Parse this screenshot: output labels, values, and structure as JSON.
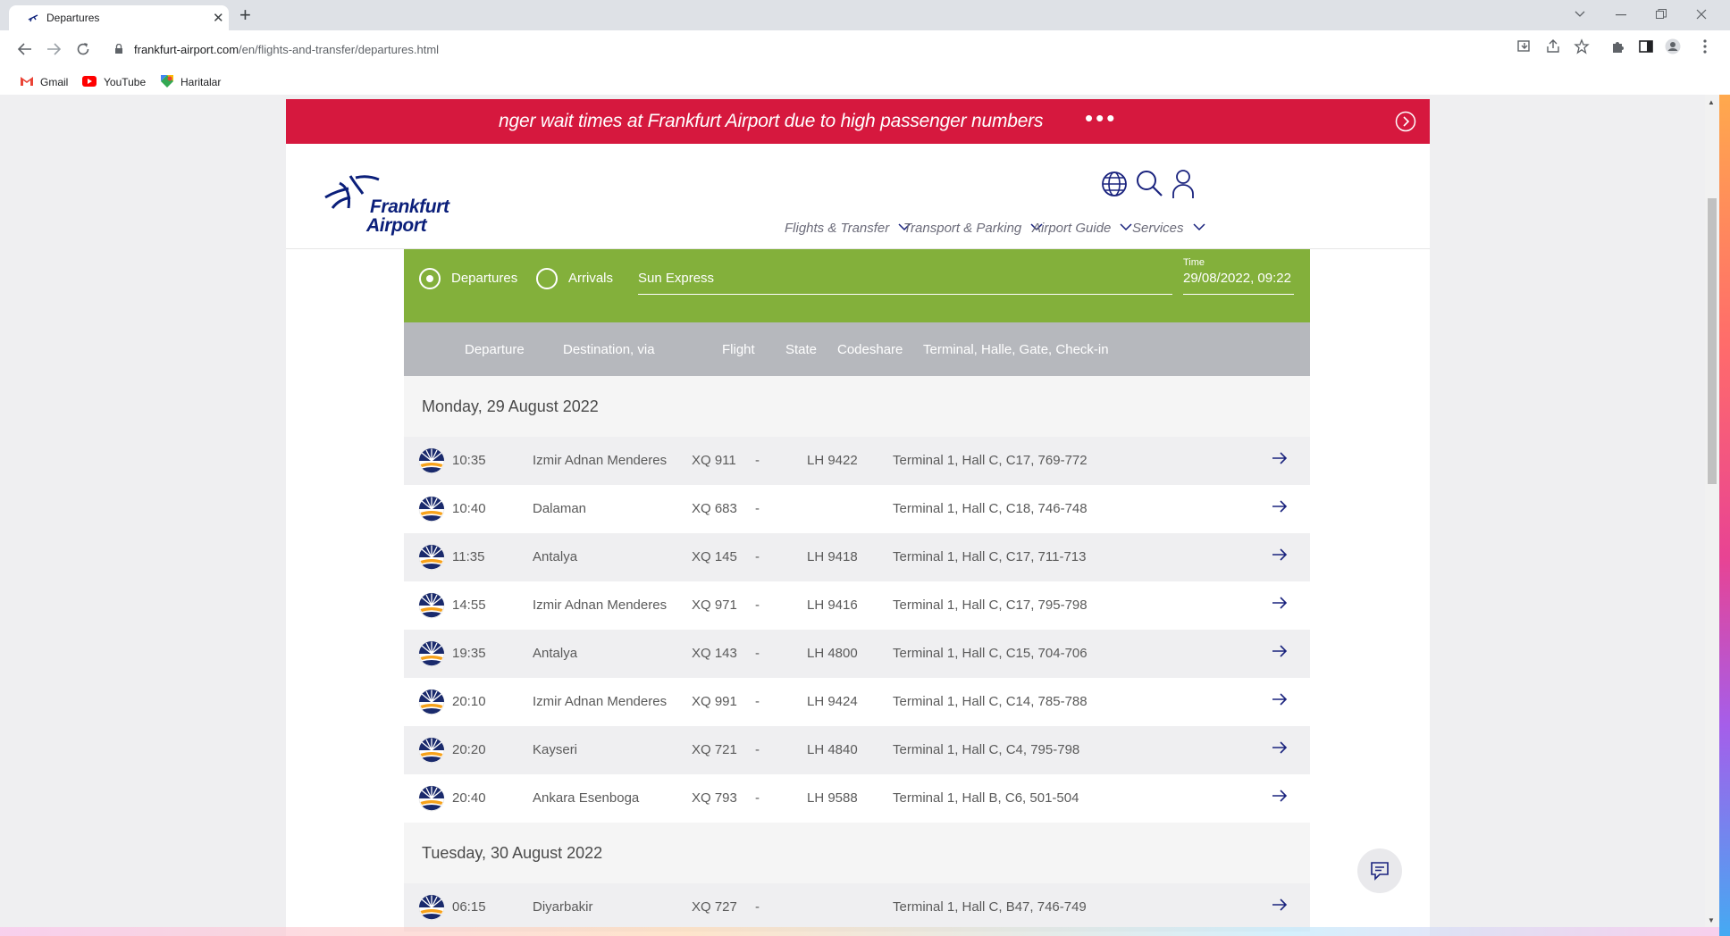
{
  "browser": {
    "tab_title": "Departures",
    "tab_close": "✕",
    "new_tab": "+",
    "url_host": "frankfurt-airport.com",
    "url_path": "/en/flights-and-transfer/departures.html",
    "bookmarks": [
      {
        "label": "Gmail",
        "icon": "gmail-icon"
      },
      {
        "label": "YouTube",
        "icon": "youtube-icon"
      },
      {
        "label": "Haritalar",
        "icon": "maps-icon"
      }
    ]
  },
  "banner": {
    "text": "nger wait times at Frankfurt Airport due to high passenger numbers",
    "dots": "•••"
  },
  "site": {
    "logo_line1": "Frankfurt",
    "logo_line2": "Airport",
    "menu": [
      "Flights & Transfer",
      "Transport & Parking",
      "Airport Guide",
      "Services"
    ]
  },
  "filter": {
    "departures_label": "Departures",
    "arrivals_label": "Arrivals",
    "search_value": "Sun Express",
    "time_label": "Time",
    "time_value": "29/08/2022, 09:22"
  },
  "table": {
    "columns": [
      "Departure",
      "Destination, via",
      "Flight",
      "State",
      "Codeshare",
      "Terminal, Halle, Gate, Check-in"
    ],
    "days": [
      {
        "date": "Monday, 29 August 2022",
        "flights": [
          {
            "time": "10:35",
            "destination": "Izmir Adnan Menderes",
            "flight": "XQ 911",
            "state": "-",
            "codeshare": "LH 9422",
            "terminal": "Terminal 1, Hall C, C17, 769-772"
          },
          {
            "time": "10:40",
            "destination": "Dalaman",
            "flight": "XQ 683",
            "state": "-",
            "codeshare": "",
            "terminal": "Terminal 1, Hall C, C18, 746-748"
          },
          {
            "time": "11:35",
            "destination": "Antalya",
            "flight": "XQ 145",
            "state": "-",
            "codeshare": "LH 9418",
            "terminal": "Terminal 1, Hall C, C17, 711-713"
          },
          {
            "time": "14:55",
            "destination": "Izmir Adnan Menderes",
            "flight": "XQ 971",
            "state": "-",
            "codeshare": "LH 9416",
            "terminal": "Terminal 1, Hall C, C17, 795-798"
          },
          {
            "time": "19:35",
            "destination": "Antalya",
            "flight": "XQ 143",
            "state": "-",
            "codeshare": "LH 4800",
            "terminal": "Terminal 1, Hall C, C15, 704-706"
          },
          {
            "time": "20:10",
            "destination": "Izmir Adnan Menderes",
            "flight": "XQ 991",
            "state": "-",
            "codeshare": "LH 9424",
            "terminal": "Terminal 1, Hall C, C14, 785-788"
          },
          {
            "time": "20:20",
            "destination": "Kayseri",
            "flight": "XQ 721",
            "state": "-",
            "codeshare": "LH 4840",
            "terminal": "Terminal 1, Hall C, C4, 795-798"
          },
          {
            "time": "20:40",
            "destination": "Ankara Esenboga",
            "flight": "XQ 793",
            "state": "-",
            "codeshare": "LH 9588",
            "terminal": "Terminal 1, Hall B, C6, 501-504"
          }
        ]
      },
      {
        "date": "Tuesday, 30 August 2022",
        "flights": [
          {
            "time": "06:15",
            "destination": "Diyarbakir",
            "flight": "XQ 727",
            "state": "-",
            "codeshare": "",
            "terminal": "Terminal 1, Hall C, B47, 746-749"
          }
        ]
      }
    ]
  },
  "colors": {
    "banner": "#d6183e",
    "filter": "#83b03b",
    "table_header": "#b6b8bd",
    "brand_navy": "#0b1f7a"
  }
}
